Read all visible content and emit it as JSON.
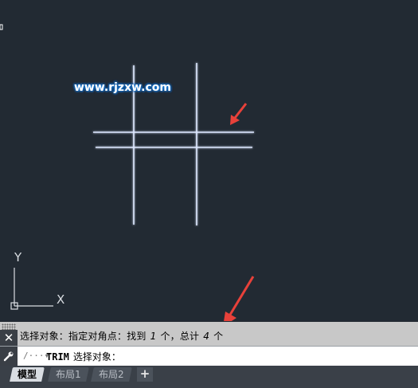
{
  "watermark": "www.rjzxw.com",
  "ucs": {
    "y_label": "Y",
    "x_label": "X"
  },
  "command": {
    "history_prefix": "选择对象：指定对角点：找到",
    "found_count": "1",
    "unit1": "个，总计",
    "total_count": "4",
    "unit2": "个",
    "prompt_icon": "/···▾",
    "current_command": "TRIM",
    "current_prompt": "选择对象："
  },
  "tabs": [
    "模型",
    "布局1",
    "布局2"
  ],
  "add_tab_label": "+",
  "colors": {
    "canvas_bg": "#222a33",
    "line_color": "#dde8ff",
    "line_glow": "#3b78ff",
    "arrow_color": "#e8413a"
  }
}
